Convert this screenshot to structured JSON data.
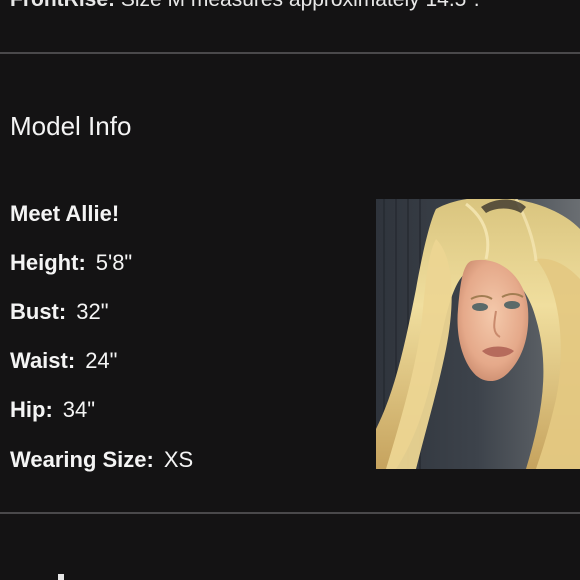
{
  "top_line": {
    "label": "FrontRise:",
    "value": "Size M measures approximately 14.5\"."
  },
  "model_info": {
    "title": "Model Info",
    "intro": "Meet Allie!",
    "rows": [
      {
        "label": "Height:",
        "value": "5'8\""
      },
      {
        "label": "Bust:",
        "value": "32\""
      },
      {
        "label": "Waist:",
        "value": "24\""
      },
      {
        "label": "Hip:",
        "value": "34\""
      },
      {
        "label": "Wearing Size:",
        "value": "XS"
      }
    ]
  },
  "colors": {
    "background": "#141314",
    "divider": "#4a494b",
    "text": "#f4f4f4"
  }
}
